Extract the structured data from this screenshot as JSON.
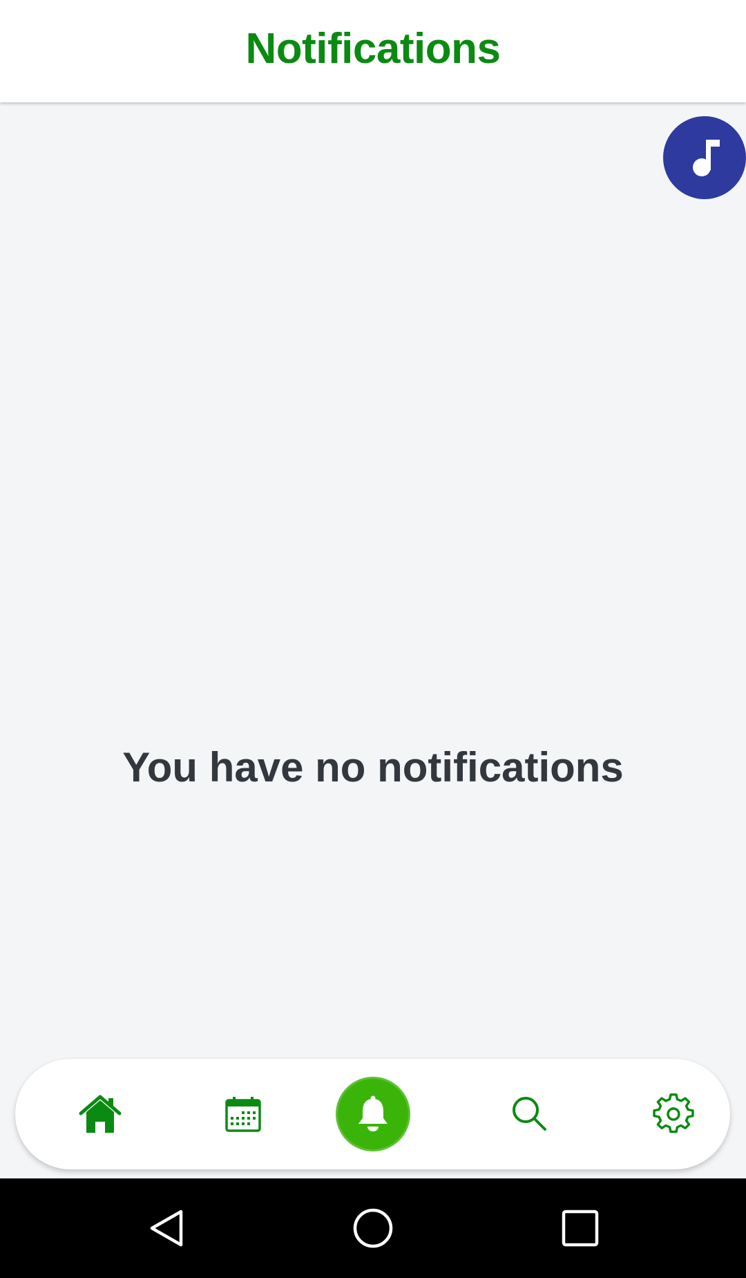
{
  "header": {
    "title": "Notifications"
  },
  "content": {
    "empty_message": "You have no notifications"
  },
  "fab": {
    "icon": "music-note-icon"
  },
  "bottom_nav": {
    "items": [
      {
        "icon": "home-icon",
        "active": false
      },
      {
        "icon": "calendar-icon",
        "active": false
      },
      {
        "icon": "bell-icon",
        "active": true
      },
      {
        "icon": "search-icon",
        "active": false
      },
      {
        "icon": "gear-icon",
        "active": false
      }
    ]
  },
  "system_nav": {
    "items": [
      {
        "icon": "back-triangle-icon"
      },
      {
        "icon": "home-circle-icon"
      },
      {
        "icon": "recents-square-icon"
      }
    ]
  },
  "colors": {
    "brand_green": "#0b8a12",
    "active_green": "#3bb40a",
    "fab_blue": "#2e3a9e",
    "text_dark": "#33383f",
    "background": "#f4f5f7"
  }
}
